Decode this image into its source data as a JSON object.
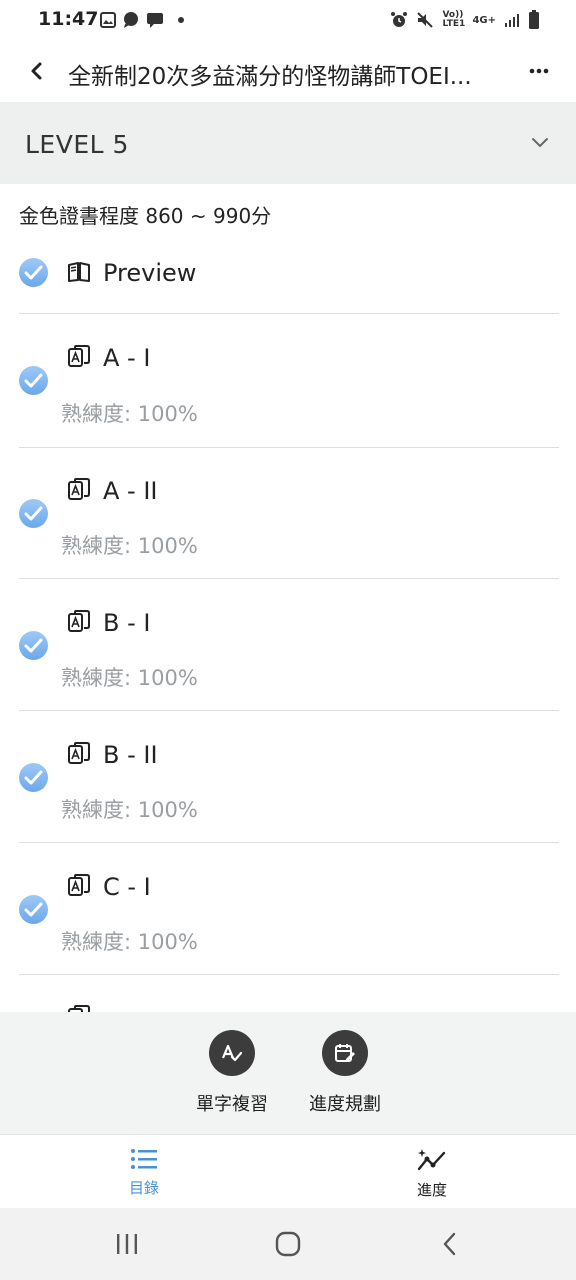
{
  "status_bar": {
    "time": "11:47",
    "left_icons": [
      "gallery-icon",
      "chat-icon",
      "message-icon",
      "dot-icon"
    ],
    "right_icons": [
      "alarm-icon",
      "mute-icon",
      "volte-icon",
      "4g-icon",
      "signal-icon",
      "battery-icon"
    ],
    "volte_label": "Vo)) LTE1",
    "network_label": "4G+"
  },
  "app_bar": {
    "title": "全新制20次多益滿分的怪物講師TOEI..."
  },
  "level": {
    "label": "LEVEL 5"
  },
  "subtitle": "金色證書程度 860 ~ 990分",
  "preview": {
    "label": "Preview",
    "checked": true
  },
  "lessons": [
    {
      "name": "A - I",
      "progress": "熟練度: 100%",
      "checked": true
    },
    {
      "name": "A - II",
      "progress": "熟練度: 100%",
      "checked": true
    },
    {
      "name": "B - I",
      "progress": "熟練度: 100%",
      "checked": true
    },
    {
      "name": "B - II",
      "progress": "熟練度: 100%",
      "checked": true
    },
    {
      "name": "C - I",
      "progress": "熟練度: 100%",
      "checked": true
    }
  ],
  "actions": {
    "review_label": "單字複習",
    "plan_label": "進度規劃"
  },
  "bottom_nav": {
    "toc_label": "目錄",
    "progress_label": "進度",
    "active_color": "#4a90d9"
  }
}
